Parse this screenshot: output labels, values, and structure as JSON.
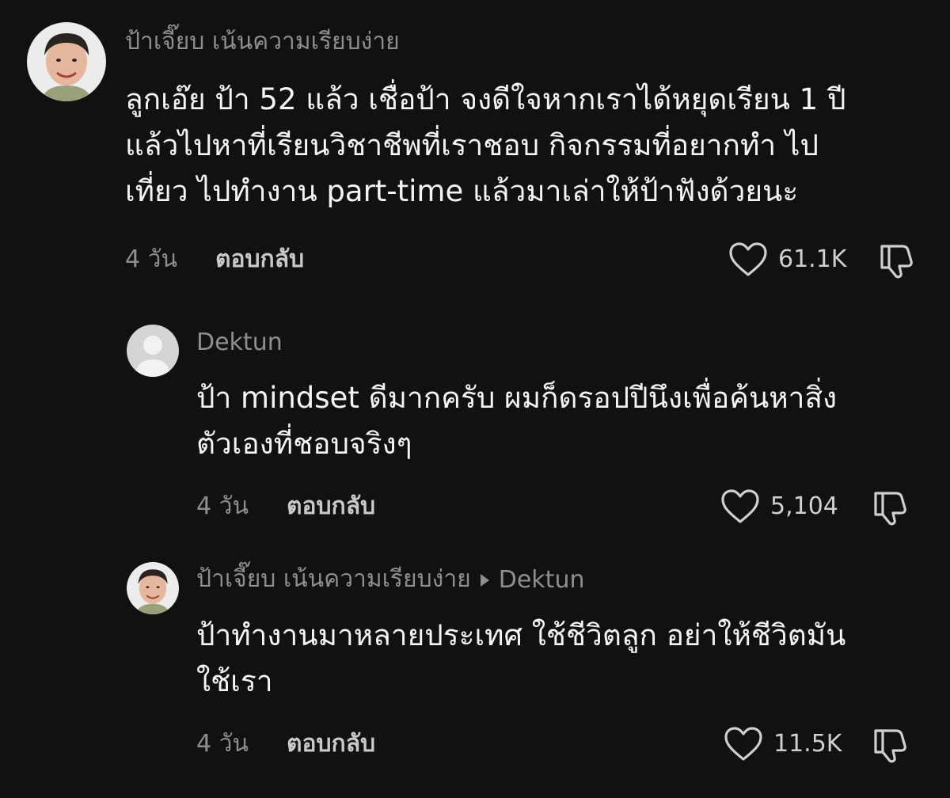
{
  "comments": [
    {
      "username": "ป้าเจี๊ยบ เน้นความเรียบง่าย",
      "text": "ลูกเอ๊ย ป้า 52 แล้ว เชื่อป้า จงดีใจหากเราได้หยุดเรียน 1 ปี\nแล้วไปหาที่เรียนวิชาชีพที่เราชอบ กิจกรรมที่อยากทำ ไป\nเที่ยว ไปทำงาน part-time แล้วมาเล่าให้ป้าฟังด้วยนะ",
      "time": "4 วัน",
      "reply_label": "ตอบกลับ",
      "likes": "61.1K",
      "avatar_icon": "user-photo-avatar"
    },
    {
      "username": "Dektun",
      "text": "ป้า mindset ดีมากครับ ผมก็ดรอปปีนึงเพื่อค้นหาสิ่ง\nตัวเองที่ชอบจริงๆ",
      "time": "4 วัน",
      "reply_label": "ตอบกลับ",
      "likes": "5,104",
      "avatar_icon": "default-user-avatar"
    },
    {
      "username": "ป้าเจี๊ยบ เน้นความเรียบง่าย",
      "reply_to": "Dektun",
      "text": "ป้าทำงานมาหลายประเทศ ใช้ชีวิตลูก อย่าให้ชีวิตมัน\nใช้เรา",
      "time": "4 วัน",
      "reply_label": "ตอบกลับ",
      "likes": "11.5K",
      "avatar_icon": "user-photo-avatar"
    }
  ],
  "colors": {
    "background": "#111111",
    "text": "#f5f5f5",
    "muted": "#8e8e90"
  }
}
